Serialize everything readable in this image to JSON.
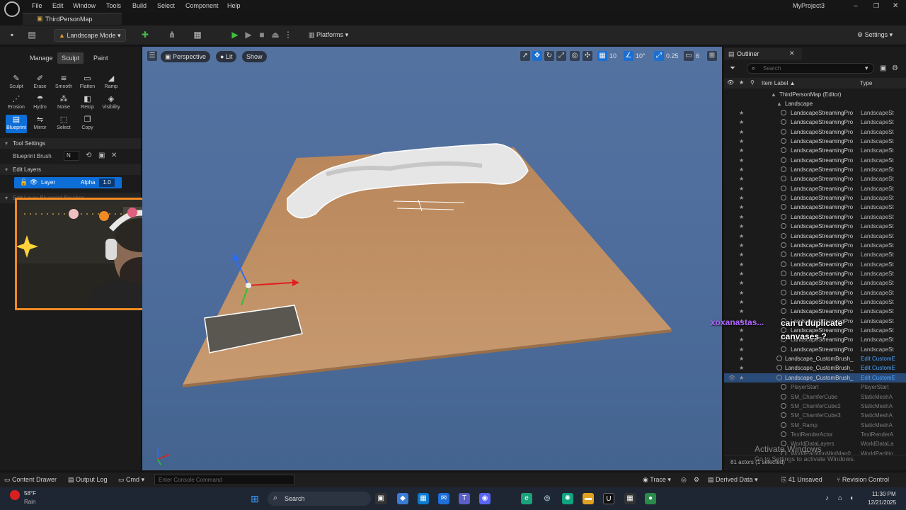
{
  "window": {
    "project_name": "MyProject3",
    "map_tab": "ThirdPersonMap",
    "menu": [
      "File",
      "Edit",
      "Window",
      "Tools",
      "Build",
      "Select",
      "Component",
      "Help"
    ]
  },
  "toolbar": {
    "mode_label": "Landscape Mode",
    "platforms_label": "Platforms",
    "settings_label": "Settings"
  },
  "landscape_panel": {
    "tabs": [
      "Manage",
      "Sculpt",
      "Paint"
    ],
    "active_tab": "Sculpt",
    "tools": [
      {
        "label": "Sculpt",
        "icon": "brush-icon"
      },
      {
        "label": "Erase",
        "icon": "eraser-icon"
      },
      {
        "label": "Smooth",
        "icon": "smooth-icon"
      },
      {
        "label": "Flatten",
        "icon": "flatten-icon"
      },
      {
        "label": "Ramp",
        "icon": "ramp-icon"
      },
      {
        "label": "Erosion",
        "icon": "erosion-icon"
      },
      {
        "label": "Hydro",
        "icon": "hydro-icon"
      },
      {
        "label": "Noise",
        "icon": "noise-icon"
      },
      {
        "label": "Retop",
        "icon": "retop-icon"
      },
      {
        "label": "Visibility",
        "icon": "visibility-icon"
      },
      {
        "label": "Blueprint",
        "icon": "blueprint-icon"
      },
      {
        "label": "Mirror",
        "icon": "mirror-icon"
      },
      {
        "label": "Select",
        "icon": "select-icon"
      },
      {
        "label": "Copy",
        "icon": "copy-icon"
      }
    ],
    "tool_settings_header": "Tool Settings",
    "blueprint_brush_label": "Blueprint Brush",
    "blueprint_brush_value": "N",
    "edit_layers_header": "Edit Layers",
    "layer_name": "Layer",
    "alpha_label": "Alpha",
    "alpha_value": "1.0",
    "hidden_header": "Edit Layer Blueprint Brushes"
  },
  "viewport": {
    "perspective_label": "Perspective",
    "lit_label": "Lit",
    "show_label": "Show",
    "grid_snap": "10",
    "rotation_snap": "10°",
    "scale_snap": "0.25",
    "camera_speed": "6"
  },
  "outliner": {
    "tab_label": "Outliner",
    "search_placeholder": "Search",
    "col_label": "Item Label ▲",
    "col_type": "Type",
    "root": "ThirdPersonMap (Editor)",
    "folder": "Landscape",
    "streaming_rows": 26,
    "streaming_label": "LandscapeStreamingPro",
    "streaming_type": "LandscapeSt",
    "custom_brushes": [
      {
        "label": "Landscape_CustomBrush_",
        "type": "Edit CustomE"
      },
      {
        "label": "Landscape_CustomBrush_",
        "type": "Edit CustomE"
      },
      {
        "label": "Landscape_CustomBrush_",
        "type": "Edit CustomE"
      }
    ],
    "other_rows": [
      {
        "label": "PlayerStart",
        "type": "PlayerStart"
      },
      {
        "label": "SM_ChamferCube",
        "type": "StaticMeshA"
      },
      {
        "label": "SM_ChamferCube2",
        "type": "StaticMeshA"
      },
      {
        "label": "SM_ChamferCube3",
        "type": "StaticMeshA"
      },
      {
        "label": "SM_Ramp",
        "type": "StaticMeshA"
      },
      {
        "label": "TextRenderActor",
        "type": "TextRenderA"
      },
      {
        "label": "WorldDataLayers",
        "type": "WorldDataLa"
      },
      {
        "label": "WorldPartitionMiniMap0",
        "type": "WorldPartitio"
      }
    ],
    "footer": "81 actors (1 selected)"
  },
  "statusbar": {
    "content_drawer": "Content Drawer",
    "output_log": "Output Log",
    "cmd": "Cmd",
    "console_placeholder": "Enter Console Command",
    "trace": "Trace",
    "derived_data": "Derived Data",
    "unsaved": "41 Unsaved",
    "revision_control": "Revision Control"
  },
  "chat": {
    "username": "xoxanastas...",
    "message": "can u duplicate canvases ?"
  },
  "watermark": {
    "line1": "Activate Windows",
    "line2": "Go to Settings to activate Windows."
  },
  "taskbar": {
    "weather_temp": "58°F",
    "weather_desc": "Rain",
    "search_label": "Search",
    "time": "11:30 PM",
    "date": "12/21/2025"
  },
  "colors": {
    "accent": "#0d6ed8",
    "selection": "#2a4a78",
    "webcam_border": "#f08a24",
    "chat_user": "#b066ff",
    "play_green": "#3fbf3f"
  }
}
